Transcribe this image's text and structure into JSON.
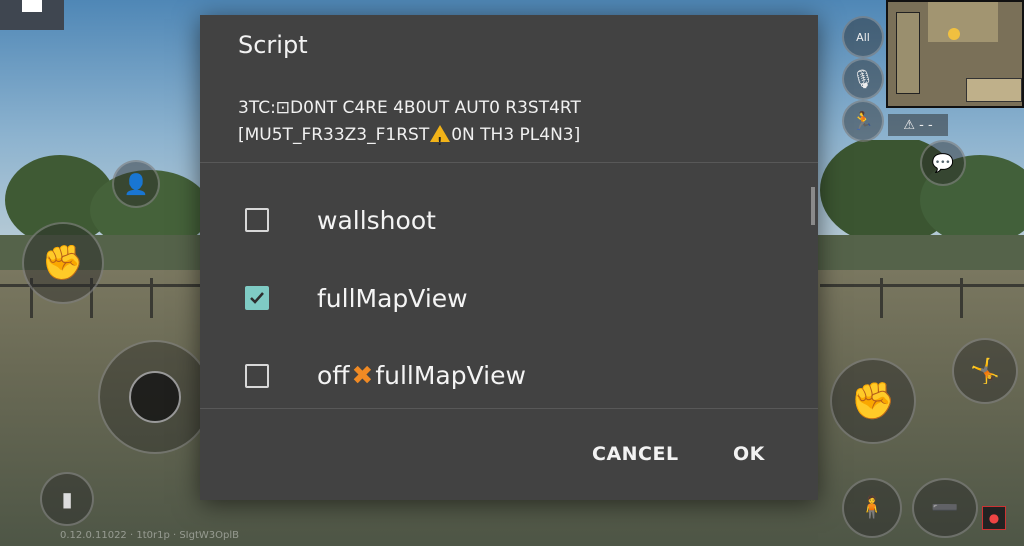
{
  "dialog": {
    "title": "Script",
    "message_line1": "3TC:⊡D0NT C4RE 4B0UT AUT0 R3ST4RT",
    "message_line2_a": "[MU5T_FR33Z3_F1RST",
    "message_line2_b": "0N TH3 PL4N3]",
    "options": [
      {
        "label": "wallshoot",
        "checked": false
      },
      {
        "label": "fullMapView",
        "checked": true
      },
      {
        "label_a": "off",
        "label_b": "fullMapView",
        "checked": false
      }
    ],
    "cancel_label": "CANCEL",
    "ok_label": "OK"
  },
  "game": {
    "version_text": "0.12.0.11022 · 1t0r1p · SIgtW3OplB",
    "minimap_label": "All"
  },
  "colors": {
    "dialog_bg": "#424242",
    "checkbox_accent": "#7fcbc4",
    "x_mark": "#f08a24",
    "warning": "#f2b318"
  }
}
